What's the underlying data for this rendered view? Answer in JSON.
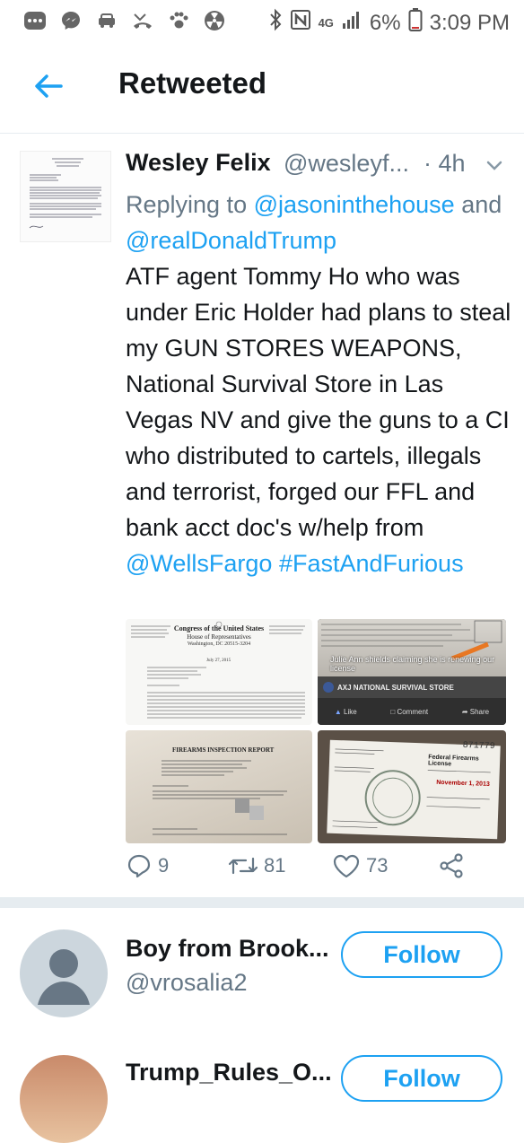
{
  "status_bar": {
    "battery": "6%",
    "time": "3:09 PM",
    "network": "4G"
  },
  "header": {
    "title": "Retweeted"
  },
  "tweet": {
    "author_name": "Wesley Felix",
    "author_handle": "@wesleyf...",
    "dot": "·",
    "time": "4h",
    "replying_prefix": "Replying to",
    "reply_to_1": "@jasoninthehouse",
    "reply_and": "and",
    "reply_to_2": "@realDonaldTrump",
    "body_text": "ATF agent Tommy Ho who was under Eric Holder had plans to steal my GUN STORES WEAPONS, National Survival Store in Las Vegas NV and give the guns to a CI who distributed to cartels, illegals and terrorist, forged our FFL and bank acct doc's w/help from",
    "mention": "@WellsFargo",
    "hashtag": "#FastAndFurious",
    "media": {
      "doc1_heading": "Congress of the United States",
      "doc1_sub": "House of Representatives",
      "doc1_city": "Washington, DC 20515-3204",
      "doc1_date": "July 27, 2015",
      "fb_caption": "Julie Ann shields claiming she is renewing our license",
      "fb_page": "AXJ NATIONAL SURVIVAL STORE",
      "fb_like": "Like",
      "fb_comment": "Comment",
      "fb_share": "Share",
      "doc3_heading": "FIREARMS INSPECTION REPORT",
      "doc4_heading": "Federal Firearms License",
      "doc4_number": "871779",
      "doc4_date": "November 1, 2013"
    },
    "actions": {
      "replies": "9",
      "retweets": "81",
      "likes": "73"
    }
  },
  "suggestion_1": {
    "name": "Boy from Brook...",
    "handle": "@vrosalia2",
    "follow_label": "Follow"
  },
  "suggestion_2": {
    "name": "Trump_Rules_O...",
    "follow_label": "Follow"
  },
  "colors": {
    "accent": "#1da1f2",
    "secondary_text": "#657786",
    "primary_text": "#14171a",
    "divider": "#e6ecf0"
  }
}
